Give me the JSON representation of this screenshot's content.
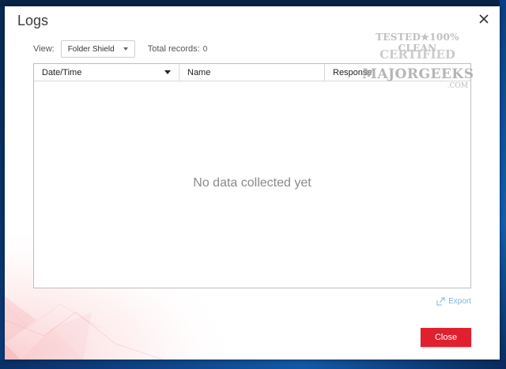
{
  "dialog": {
    "title": "Logs",
    "close_icon": "close-icon"
  },
  "filter": {
    "view_label": "View:",
    "view_value": "Folder Shield",
    "records_label": "Total records:",
    "records_count": "0"
  },
  "table": {
    "columns": [
      "Date/Time",
      "Name",
      "Response"
    ],
    "sorted_column": "Date/Time",
    "empty_message": "No data collected yet"
  },
  "footer": {
    "export_label": "Export",
    "export_icon": "export-icon",
    "close_label": "Close"
  },
  "watermark": {
    "line1": "TESTED★100% CLEAN",
    "line2": "CERTIFIED",
    "line3": "MAJORGEEKS",
    "line4": ".COM"
  },
  "colors": {
    "accent": "#e0202e",
    "link": "#7fb4e0"
  }
}
